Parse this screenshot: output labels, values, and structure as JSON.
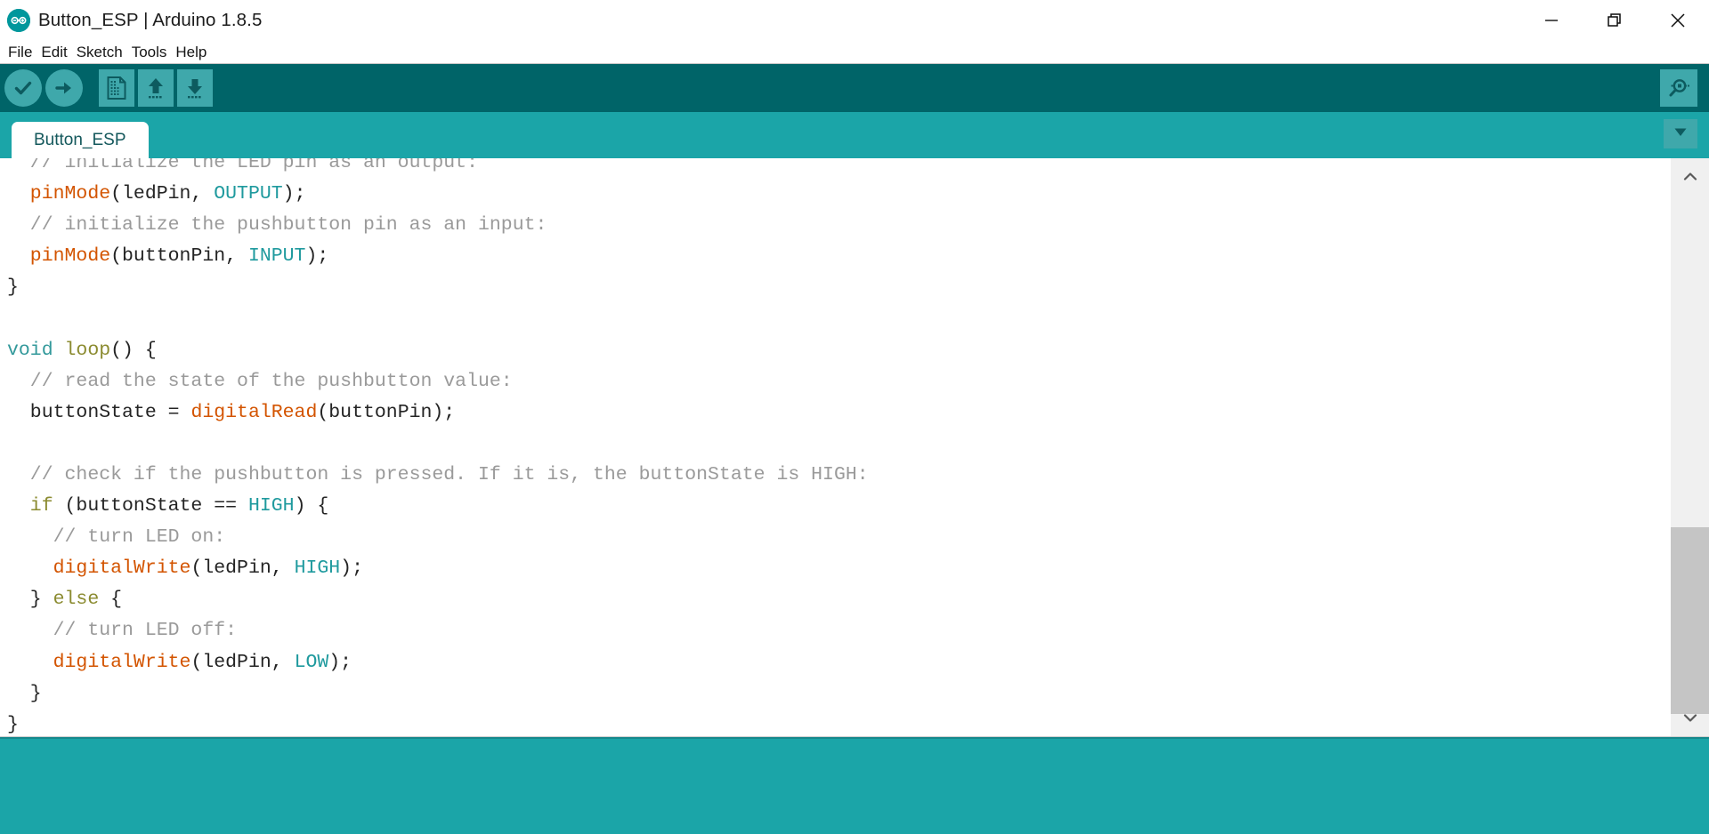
{
  "window": {
    "title": "Button_ESP | Arduino 1.8.5",
    "logo_icon": "arduino-infinity-logo",
    "controls": [
      {
        "name": "minimize",
        "icon": "minimize-icon"
      },
      {
        "name": "restore",
        "icon": "restore-icon"
      },
      {
        "name": "close",
        "icon": "close-icon"
      }
    ]
  },
  "menubar": {
    "items": [
      {
        "label": "File"
      },
      {
        "label": "Edit"
      },
      {
        "label": "Sketch"
      },
      {
        "label": "Tools"
      },
      {
        "label": "Help"
      }
    ]
  },
  "toolbar": {
    "background": "#006468",
    "button_color": "#3FA8AB",
    "buttons": [
      {
        "name": "verify-button",
        "icon": "checkmark-icon",
        "shape": "round"
      },
      {
        "name": "upload-button",
        "icon": "arrow-right-icon",
        "shape": "round"
      },
      {
        "name": "new-button",
        "icon": "new-document-icon",
        "shape": "square"
      },
      {
        "name": "open-button",
        "icon": "arrow-up-open-icon",
        "shape": "square"
      },
      {
        "name": "save-button",
        "icon": "arrow-down-save-icon",
        "shape": "square"
      }
    ],
    "serial_monitor": {
      "name": "serial-monitor-button",
      "icon": "magnifier-icon"
    }
  },
  "tabbar": {
    "background": "#1BA5A8",
    "tabs": [
      {
        "label": "Button_ESP",
        "active": true
      }
    ],
    "dropdown": {
      "name": "tab-menu-button",
      "icon": "chevron-down-icon"
    }
  },
  "editor": {
    "scroll_position": "partial",
    "lines": [
      [
        {
          "t": "comment",
          "s": "  // initialize the LED pin as an output:"
        }
      ],
      [
        {
          "t": "func",
          "s": "  pinMode"
        },
        {
          "t": "plain",
          "s": "(ledPin, "
        },
        {
          "t": "const",
          "s": "OUTPUT"
        },
        {
          "t": "plain",
          "s": ");"
        }
      ],
      [
        {
          "t": "comment",
          "s": "  // initialize the pushbutton pin as an input:"
        }
      ],
      [
        {
          "t": "func",
          "s": "  pinMode"
        },
        {
          "t": "plain",
          "s": "(buttonPin, "
        },
        {
          "t": "const",
          "s": "INPUT"
        },
        {
          "t": "plain",
          "s": ");"
        }
      ],
      [
        {
          "t": "plain",
          "s": "}"
        }
      ],
      [
        {
          "t": "plain",
          "s": ""
        }
      ],
      [
        {
          "t": "keyword",
          "s": "void"
        },
        {
          "t": "plain",
          "s": " "
        },
        {
          "t": "ctrl",
          "s": "loop"
        },
        {
          "t": "plain",
          "s": "() {"
        }
      ],
      [
        {
          "t": "comment",
          "s": "  // read the state of the pushbutton value:"
        }
      ],
      [
        {
          "t": "plain",
          "s": "  buttonState = "
        },
        {
          "t": "func",
          "s": "digitalRead"
        },
        {
          "t": "plain",
          "s": "(buttonPin);"
        }
      ],
      [
        {
          "t": "plain",
          "s": ""
        }
      ],
      [
        {
          "t": "comment",
          "s": "  // check if the pushbutton is pressed. If it is, the buttonState is HIGH:"
        }
      ],
      [
        {
          "t": "ctrl",
          "s": "  if"
        },
        {
          "t": "plain",
          "s": " (buttonState == "
        },
        {
          "t": "const",
          "s": "HIGH"
        },
        {
          "t": "plain",
          "s": ") {"
        }
      ],
      [
        {
          "t": "comment",
          "s": "    // turn LED on:"
        }
      ],
      [
        {
          "t": "func",
          "s": "    digitalWrite"
        },
        {
          "t": "plain",
          "s": "(ledPin, "
        },
        {
          "t": "const",
          "s": "HIGH"
        },
        {
          "t": "plain",
          "s": ");"
        }
      ],
      [
        {
          "t": "plain",
          "s": "  } "
        },
        {
          "t": "ctrl",
          "s": "else"
        },
        {
          "t": "plain",
          "s": " {"
        }
      ],
      [
        {
          "t": "comment",
          "s": "    // turn LED off:"
        }
      ],
      [
        {
          "t": "func",
          "s": "    digitalWrite"
        },
        {
          "t": "plain",
          "s": "(ledPin, "
        },
        {
          "t": "const",
          "s": "LOW"
        },
        {
          "t": "plain",
          "s": ");"
        }
      ],
      [
        {
          "t": "plain",
          "s": "  }"
        }
      ],
      [
        {
          "t": "plain",
          "s": "}"
        }
      ]
    ],
    "scrollbar": {
      "up_icon": "chevron-up-icon",
      "down_icon": "chevron-down-icon"
    }
  },
  "console": {
    "background": "#1BA5A8",
    "text": ""
  }
}
